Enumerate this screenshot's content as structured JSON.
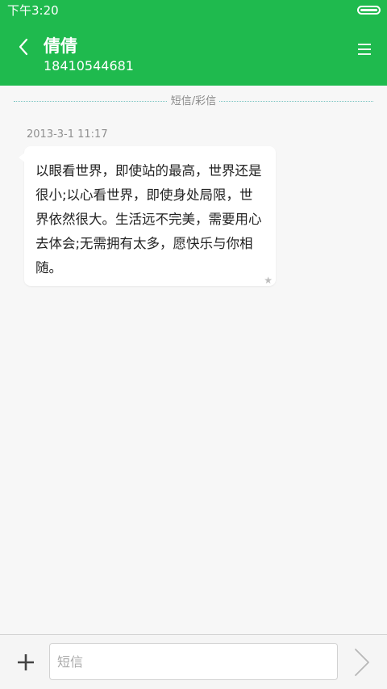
{
  "status_bar": {
    "time": "下午3:20"
  },
  "header": {
    "contact_name": "倩倩",
    "contact_number": "18410544681"
  },
  "conversation": {
    "divider_label": "短信/彩信",
    "messages": [
      {
        "timestamp": "2013-3-1 11:17",
        "text": "以眼看世界，即使站的最高，世界还是很小;以心看世界，即使身处局限，世界依然很大。生活远不完美，需要用心去体会;无需拥有太多，愿快乐与你相随。",
        "starred": true
      }
    ]
  },
  "composer": {
    "placeholder": "短信",
    "value": ""
  },
  "colors": {
    "accent": "#1fba4e",
    "background": "#f7f7f7",
    "bubble": "#ffffff"
  },
  "icons": {
    "back": "back-chevron-icon",
    "menu": "menu-icon",
    "star": "star-icon",
    "add": "plus-icon",
    "send": "send-chevron-icon",
    "battery": "battery-icon"
  }
}
